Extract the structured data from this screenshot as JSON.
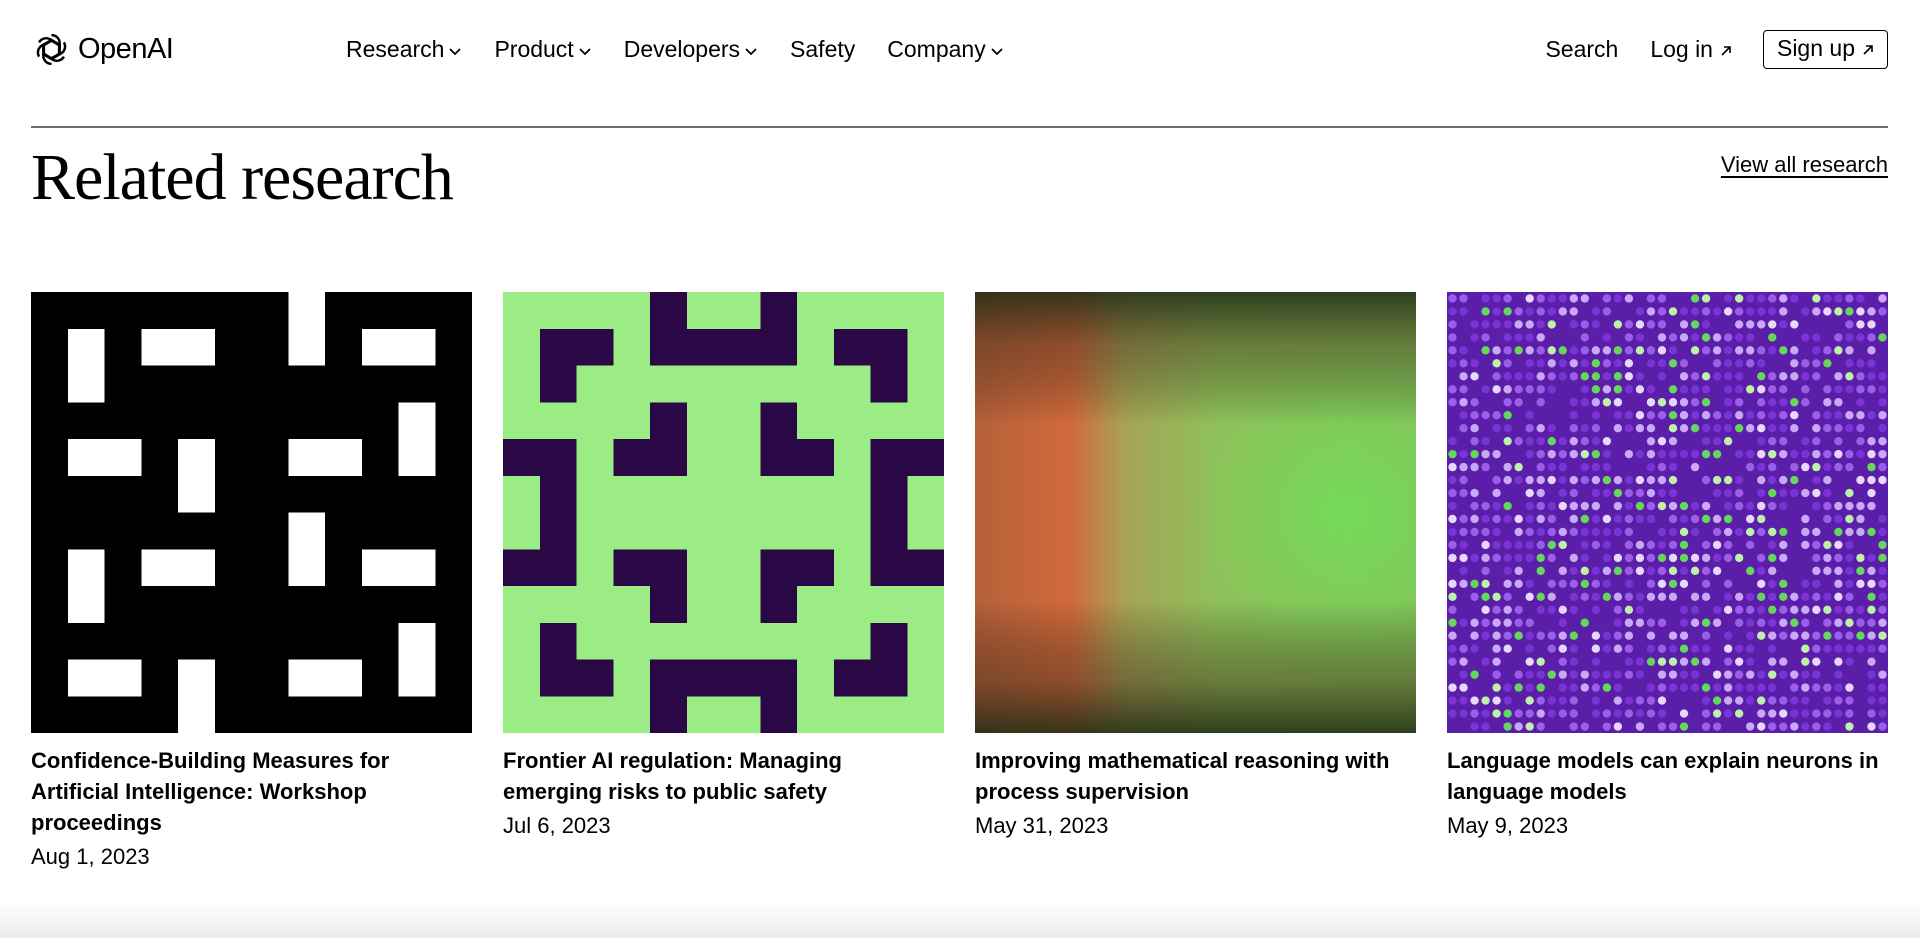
{
  "header": {
    "logo_text": "OpenAI",
    "nav": [
      {
        "label": "Research",
        "dropdown": true
      },
      {
        "label": "Product",
        "dropdown": true
      },
      {
        "label": "Developers",
        "dropdown": true
      },
      {
        "label": "Safety",
        "dropdown": false
      },
      {
        "label": "Company",
        "dropdown": true
      }
    ],
    "search_label": "Search",
    "login_label": "Log in",
    "signup_label": "Sign up"
  },
  "section": {
    "title": "Related research",
    "view_all_label": "View all research"
  },
  "cards": [
    {
      "title": "Confidence-Building Measures for Artificial Intelligence: Workshop proceedings",
      "date": "Aug 1, 2023"
    },
    {
      "title": "Frontier AI regulation: Managing emerging risks to public safety",
      "date": "Jul 6, 2023"
    },
    {
      "title": "Improving mathematical reasoning with process supervision",
      "date": "May 31, 2023"
    },
    {
      "title": "Language models can explain neurons in language models",
      "date": "May 9, 2023"
    }
  ],
  "colors": {
    "card2_bg": "#9bec85",
    "card2_shape": "#2a0845",
    "card4_bg": "#5a1ea8"
  }
}
